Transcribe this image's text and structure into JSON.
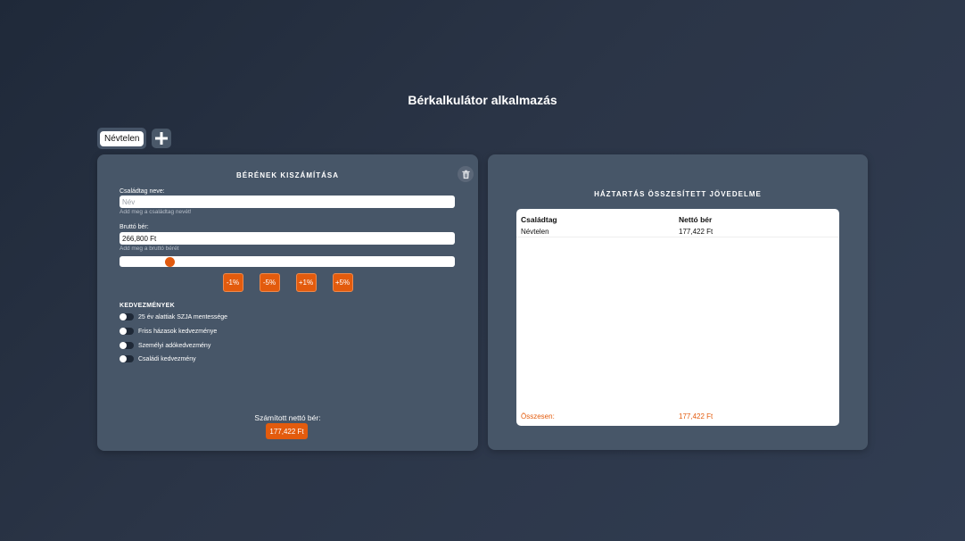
{
  "app": {
    "title": "Bérkalkulátor alkalmazás"
  },
  "tabs": {
    "items": [
      "Névtelen"
    ],
    "add_label": "+"
  },
  "calculator": {
    "heading": "Bérének kiszámítása",
    "name_label": "Családtag neve:",
    "name_placeholder": "Név",
    "name_value": "",
    "name_hint": "Add meg a családtag nevét!",
    "gross_label": "Bruttó bér:",
    "gross_value": "266,800 Ft",
    "gross_hint": "Add meg a bruttó bérét",
    "slider_fraction": 0.148,
    "buttons": [
      "-1%",
      "-5%",
      "+1%",
      "+5%"
    ],
    "benefits_title": "Kedvezmények",
    "benefits": [
      {
        "label": "25 év alattiak SZJA mentessége",
        "on": false
      },
      {
        "label": "Friss házasok kedvezménye",
        "on": false
      },
      {
        "label": "Személyi adókedvezmény",
        "on": false
      },
      {
        "label": "Családi kedvezmény",
        "on": false
      }
    ],
    "net_label": "Számított nettó bér:",
    "net_value": "177,422 Ft"
  },
  "household": {
    "heading": "Háztartás összesített jövedelme",
    "col_member": "Családtag",
    "col_net": "Nettó bér",
    "rows": [
      {
        "member": "Névtelen",
        "net": "177,422 Ft"
      }
    ],
    "total_label": "Összesen:",
    "total_value": "177,422 Ft"
  },
  "colors": {
    "accent": "#e35b0d",
    "panel": "#475668",
    "background": "#2b3547"
  },
  "icons": {
    "add": "plus-icon",
    "delete": "trash-icon"
  }
}
